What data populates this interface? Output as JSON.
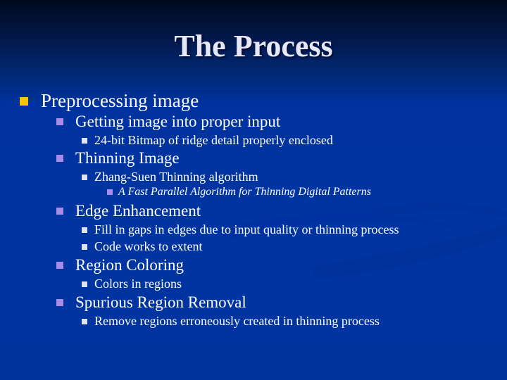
{
  "slide": {
    "title": "The Process",
    "colors": {
      "background": "#0033a0",
      "title_text": "#e6e8f8",
      "bullet_level1": "#f7c600",
      "bullet_level2": "#a98be8",
      "bullet_level3": "#dfe3f6"
    },
    "bullets": [
      {
        "level": 1,
        "text": "Preprocessing image"
      },
      {
        "level": 2,
        "text": "Getting image into proper input"
      },
      {
        "level": 3,
        "text": "24-bit Bitmap of ridge detail properly enclosed"
      },
      {
        "level": 2,
        "text": "Thinning Image"
      },
      {
        "level": 3,
        "text": "Zhang-Suen Thinning algorithm"
      },
      {
        "level": 4,
        "text": "A Fast Parallel Algorithm for Thinning Digital Patterns"
      },
      {
        "level": 2,
        "text": "Edge Enhancement"
      },
      {
        "level": 3,
        "text": "Fill in gaps in edges due to input quality or thinning process"
      },
      {
        "level": 3,
        "text": "Code works to extent"
      },
      {
        "level": 2,
        "text": "Region Coloring"
      },
      {
        "level": 3,
        "text": "Colors in regions"
      },
      {
        "level": 2,
        "text": "Spurious Region Removal"
      },
      {
        "level": 3,
        "text": "Remove regions erroneously created in thinning process"
      }
    ]
  }
}
